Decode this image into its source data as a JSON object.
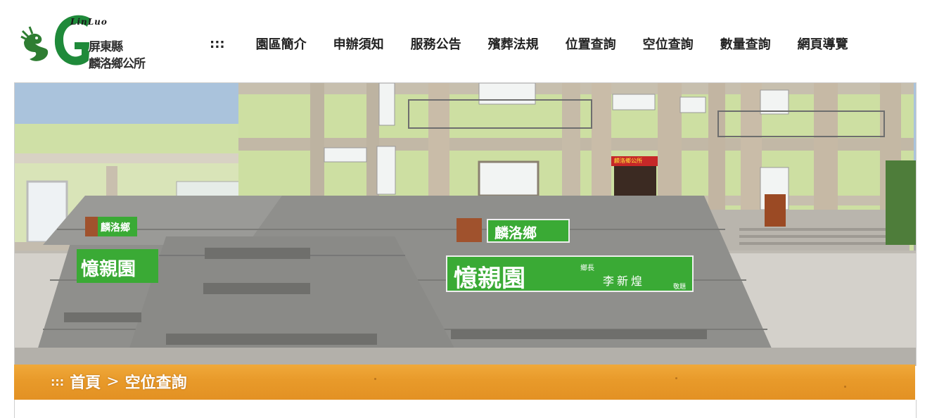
{
  "logo": {
    "en": "LinLuo",
    "zh_line1": "屏東縣",
    "zh_line2": "麟洛鄉公所"
  },
  "nav": {
    "accesskey": ":::",
    "items": [
      "園區簡介",
      "申辦須知",
      "服務公告",
      "殯葬法規",
      "位置查詢",
      "空位查詢",
      "數量查詢",
      "網頁導覽"
    ]
  },
  "banner": {
    "sign_small_left": "麟洛鄉",
    "sign_main_left": "憶親園",
    "sign_small": "麟洛鄉",
    "sign_main": "憶親園",
    "sign_title": "鄉長",
    "sign_name": "李新煌",
    "sign_inscribed": "敬題",
    "red_banner": "麟洛鄉公所"
  },
  "breadcrumb": {
    "accesskey": ":::",
    "home": "首頁",
    "separator": ">",
    "current": "空位查詢"
  },
  "colors": {
    "logo_green": "#1f8a3a",
    "sign_green": "#3aaa35",
    "crumb_orange": "#e8982a"
  }
}
